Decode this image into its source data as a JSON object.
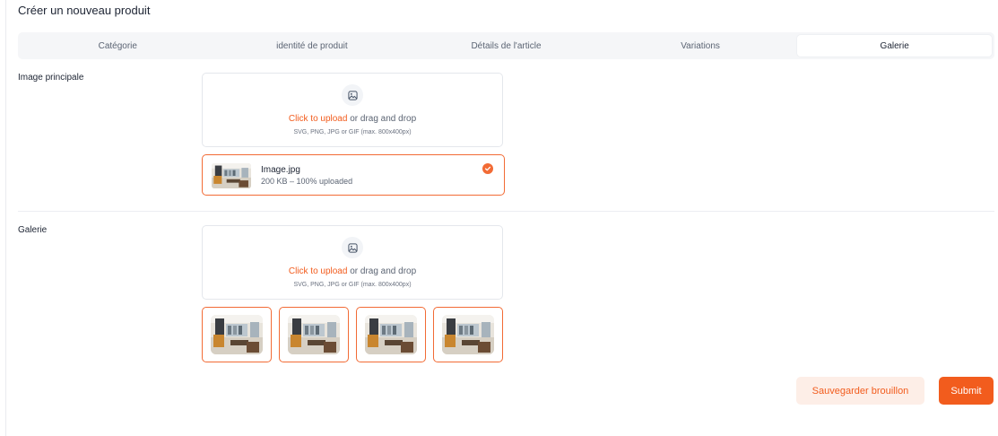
{
  "page": {
    "title": "Créer un nouveau produit"
  },
  "tabs": [
    {
      "label": "Catégorie",
      "active": false
    },
    {
      "label": "identité de produit",
      "active": false
    },
    {
      "label": "Détails de l'article",
      "active": false
    },
    {
      "label": "Variations",
      "active": false
    },
    {
      "label": "Galerie",
      "active": true
    }
  ],
  "main_image": {
    "label": "Image principale",
    "upload": {
      "icon": "image-icon",
      "link_text": "Click to upload",
      "rest_text": " or drag and drop",
      "hint": "SVG, PNG, JPG or GIF (max. 800x400px)"
    },
    "file": {
      "name": "Image.jpg",
      "meta": "200 KB – 100% uploaded",
      "progress_percent": 100,
      "status_icon": "check-circle-icon"
    }
  },
  "gallery": {
    "label": "Galerie",
    "upload": {
      "icon": "image-icon",
      "link_text": "Click to upload",
      "rest_text": " or drag and drop",
      "hint": "SVG, PNG, JPG or GIF (max. 800x400px)"
    },
    "image_count": 4
  },
  "actions": {
    "draft_label": "Sauvegarder brouillon",
    "submit_label": "Submit"
  },
  "colors": {
    "accent": "#f25c1d",
    "accent_light": "#fdeee7",
    "border": "#e4e7ec",
    "tab_bg": "#f5f6f8"
  }
}
